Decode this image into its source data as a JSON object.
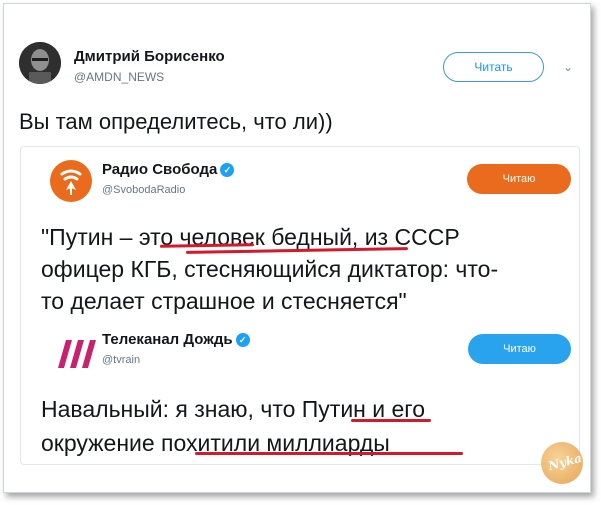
{
  "tweet": {
    "author_name": "Дмитрий Борисенко",
    "author_handle": "@AMDN_NEWS",
    "follow_label": "Читать",
    "text": "Вы там определитесь, что ли))"
  },
  "quote1": {
    "author_name": "Радио Свобода",
    "author_handle": "@SvobodaRadio",
    "button_label": "Читаю",
    "lines": [
      "\"Путин – это человек бедный, из СССР",
      "офицер КГБ, стесняющийся диктатор: что-",
      "то делает страшное и стесняется\""
    ]
  },
  "quote2": {
    "author_name": "Телеканал Дождь",
    "author_handle": "@tvrain",
    "button_label": "Читаю",
    "lines": [
      "Навальный: я знаю, что Путин и его",
      "окружение похитили миллиарды"
    ]
  },
  "watermark": {
    "text": "Nykа"
  },
  "colors": {
    "accent": "#1b95e0",
    "follow_filled": "#ea6a1e",
    "read_button_blue": "#2aa3ef",
    "underline": "#d3192c"
  }
}
